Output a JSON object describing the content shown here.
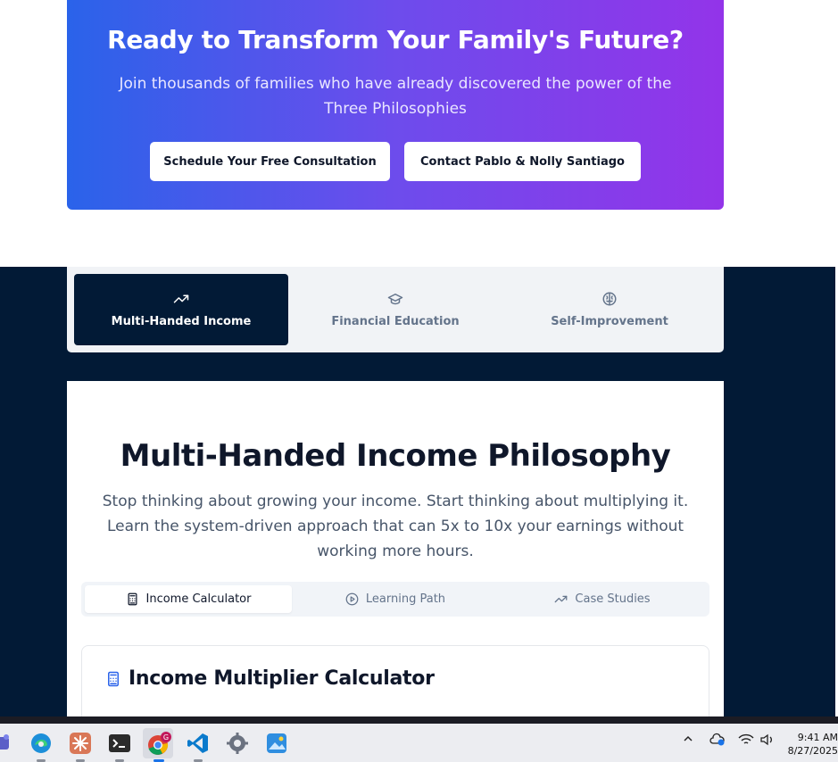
{
  "cta": {
    "title": "Ready to Transform Your Family's Future?",
    "subtitle": "Join thousands of families who have already discovered the power of the Three Philosophies",
    "primary_button": "Schedule Your Free Consultation",
    "secondary_button": "Contact Pablo & Nolly Santiago",
    "gradient_start": "#2a63ea",
    "gradient_end": "#9334e9"
  },
  "philosophy_tabs": [
    {
      "label": "Multi-Handed Income",
      "icon": "trending-up-icon",
      "active": true
    },
    {
      "label": "Financial Education",
      "icon": "graduation-cap-icon",
      "active": false
    },
    {
      "label": "Self-Improvement",
      "icon": "brain-icon",
      "active": false
    }
  ],
  "philosophy": {
    "title": "Multi-Handed Income Philosophy",
    "description": "Stop thinking about growing your income. Start thinking about multiplying it. Learn the system-driven approach that can 5x to 10x your earnings without working more hours."
  },
  "sub_tabs": [
    {
      "label": "Income Calculator",
      "icon": "calculator-icon",
      "active": true
    },
    {
      "label": "Learning Path",
      "icon": "play-circle-icon",
      "active": false
    },
    {
      "label": "Case Studies",
      "icon": "trending-up-icon",
      "active": false
    }
  ],
  "calculator": {
    "title": "Income Multiplier Calculator",
    "icon": "calculator-icon"
  },
  "colors": {
    "navy": "#021a36",
    "accent_blue": "#2a63ea"
  },
  "taskbar": {
    "apps": [
      "teams-icon",
      "edge-icon",
      "claude-icon",
      "terminal-icon",
      "chrome-icon",
      "vscode-icon",
      "settings-icon",
      "photos-icon"
    ],
    "chrome_badge": "G",
    "time": "9:41 AM",
    "date": "8/27/2025"
  }
}
